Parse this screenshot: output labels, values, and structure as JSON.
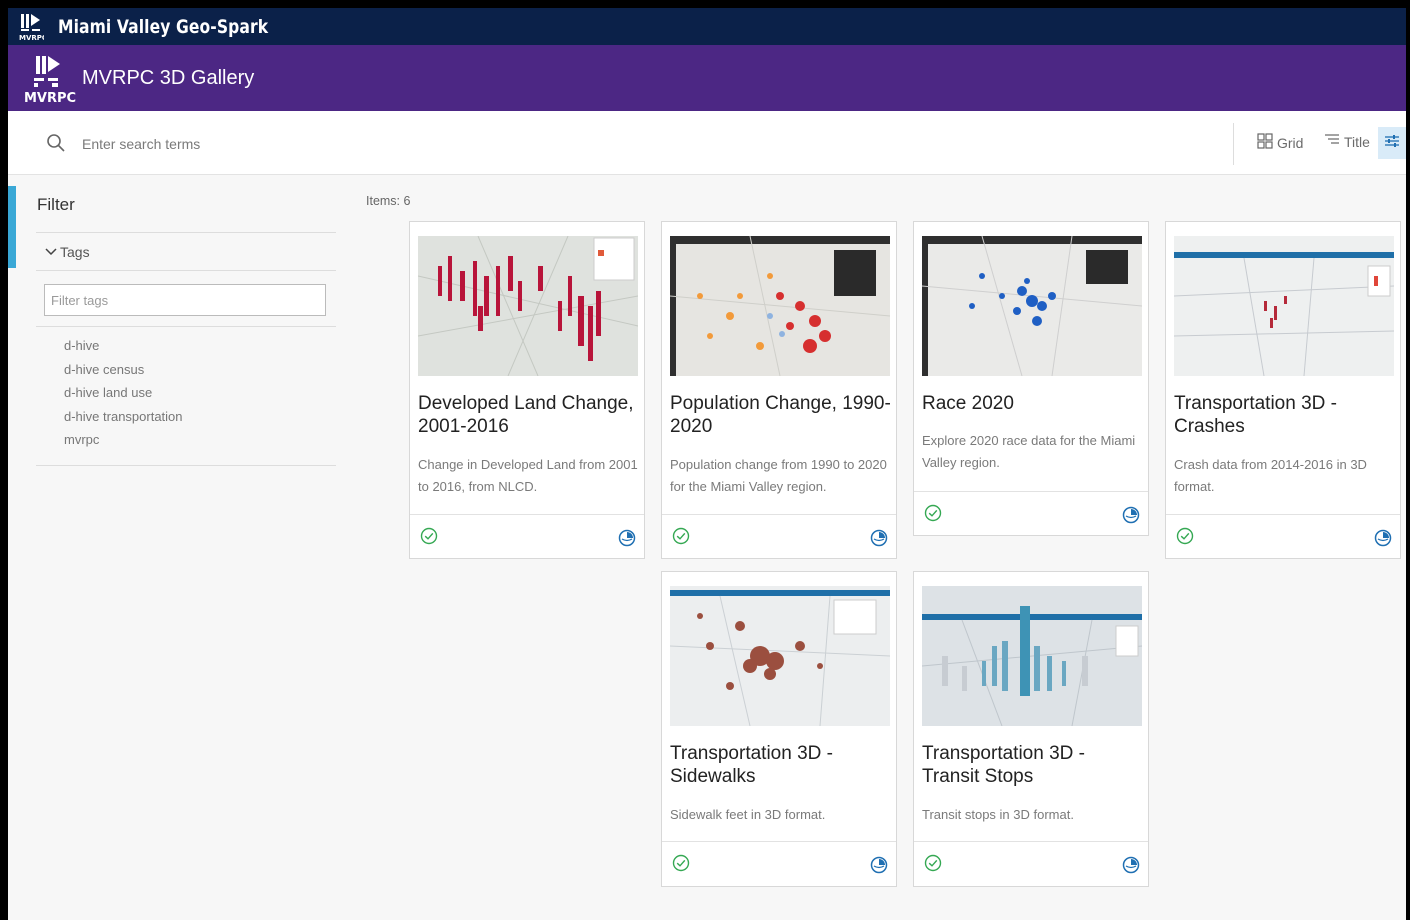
{
  "app": {
    "top_title": "Miami Valley Geo-Spark",
    "logo_text": "MVRPC",
    "gallery_title": "MVRPC 3D Gallery"
  },
  "search": {
    "placeholder": "Enter search terms"
  },
  "view": {
    "grid_label": "Grid",
    "sort_label": "Title"
  },
  "filter": {
    "title": "Filter",
    "tags_label": "Tags",
    "tags_placeholder": "Filter tags",
    "tags": [
      "d-hive",
      "d-hive census",
      "d-hive land use",
      "d-hive transportation",
      "mvrpc"
    ]
  },
  "items_count": "Items: 6",
  "cards": [
    {
      "title": "Developed Land Change, 2001-2016",
      "description": "Change in Developed Land from 2001 to 2016, from NLCD."
    },
    {
      "title": "Population Change, 1990-2020",
      "description": "Population change from 1990 to 2020 for the Miami Valley region."
    },
    {
      "title": "Race 2020",
      "description": "Explore 2020 race data for the Miami Valley region."
    },
    {
      "title": "Transportation 3D - Crashes",
      "description": "Crash data from 2014-2016 in 3D format."
    },
    {
      "title": "Transportation 3D - Sidewalks",
      "description": "Sidewalk feet in 3D format."
    },
    {
      "title": "Transportation 3D - Transit Stops",
      "description": "Transit stops in 3D format."
    }
  ],
  "colors": {
    "top_bar": "#0b2149",
    "header": "#4c2784",
    "accent": "#3aa8d6",
    "check": "#35a853",
    "scene": "#1f6fb2"
  }
}
